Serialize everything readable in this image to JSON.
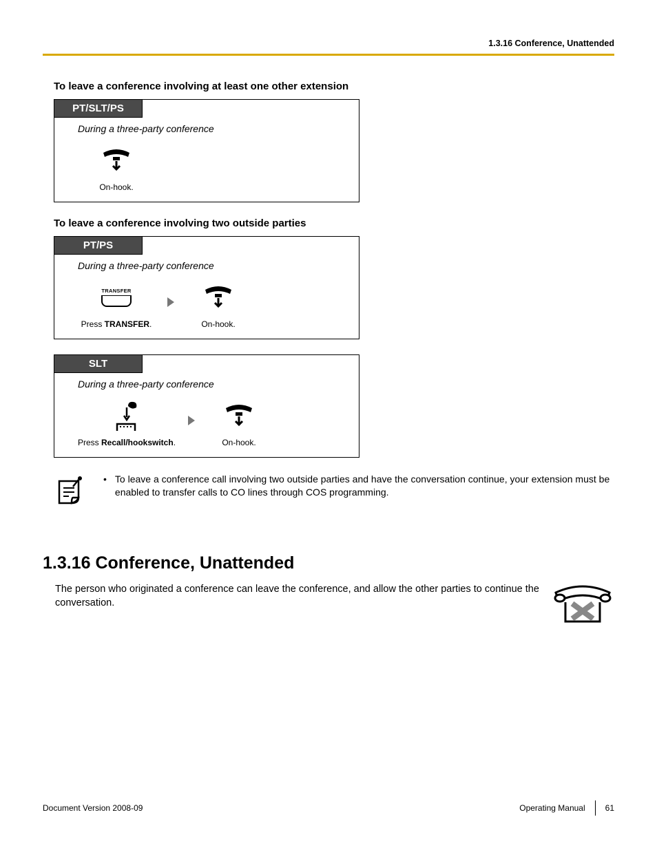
{
  "header": {
    "breadcrumb": "1.3.16 Conference, Unattended"
  },
  "sec1": {
    "title": "To leave a conference involving at least one other extension",
    "box": {
      "tab": "PT/SLT/PS",
      "context": "During a three-party conference",
      "step1_caption": "On-hook."
    }
  },
  "sec2": {
    "title": "To leave a conference involving two outside parties",
    "box_pt": {
      "tab": "PT/PS",
      "context": "During a three-party conference",
      "btn_label": "TRANSFER",
      "step1_pre": "Press ",
      "step1_bold": "TRANSFER",
      "step1_post": ".",
      "step2_caption": "On-hook."
    },
    "box_slt": {
      "tab": "SLT",
      "context": "During a three-party conference",
      "step1_pre": "Press ",
      "step1_bold": "Recall/hookswitch",
      "step1_post": ".",
      "step2_caption": "On-hook."
    }
  },
  "note": {
    "bullet": "•",
    "text": "To leave a conference call involving two outside parties and have the conversation continue, your extension must be enabled to transfer calls to CO lines through COS programming."
  },
  "section": {
    "heading": "1.3.16  Conference, Unattended",
    "body": "The person who originated a conference can leave the conference, and allow the other parties to continue the conversation."
  },
  "footer": {
    "left": "Document Version  2008-09",
    "right_label": "Operating Manual",
    "page": "61"
  }
}
